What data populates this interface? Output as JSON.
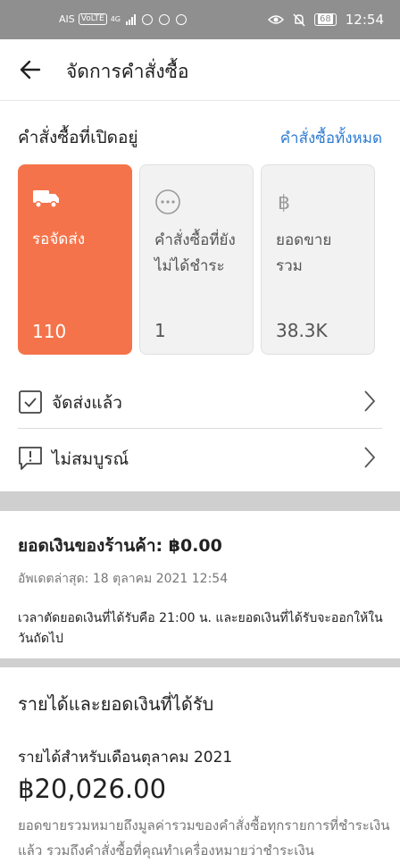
{
  "status_bar": {
    "carrier": "AIS",
    "volte": "VoLTE",
    "network": "4G",
    "battery": "68",
    "time": "12:54"
  },
  "header": {
    "title": "จัดการคำสั่งซื้อ"
  },
  "open_orders": {
    "title": "คำสั่งซื้อที่เปิดอยู่",
    "all_link": "คำสั่งซื้อทั้งหมด",
    "cards": [
      {
        "icon": "truck-icon",
        "label": "รอจัดส่ง",
        "value": "110"
      },
      {
        "icon": "more-circle-icon",
        "label": "คำสั่งซื้อที่ยังไม่ได้ชำระ",
        "value": "1"
      },
      {
        "icon": "baht-icon",
        "label": "ยอดขายรวม",
        "value": "38.3K"
      }
    ]
  },
  "rows": [
    {
      "icon": "check-box-icon",
      "label": "จัดส่งแล้ว"
    },
    {
      "icon": "alert-message-icon",
      "label": "ไม่สมบูรณ์"
    }
  ],
  "balance": {
    "title": "ยอดเงินของร้านค้า: ฿0.00",
    "updated": "อัพเดตล่าสุด: 18 ตุลาคม 2021 12:54",
    "cutoff_note": "เวลาตัดยอดเงินที่ได้รับคือ 21:00 น. และยอดเงินที่ได้รับจะออกให้ในวันถัดไป"
  },
  "income": {
    "title": "รายได้และยอดเงินที่ได้รับ",
    "month_label": "รายได้สำหรับเดือนตุลาคม 2021",
    "amount": "฿20,026.00",
    "note": "ยอดขายรวมหมายถึงมูลค่ารวมของคำสั่งซื้อทุกรายการที่ชำระเงินแล้ว รวมถึงคำสั่งซื้อที่คุณทำเครื่องหมายว่าชำระเงิน"
  },
  "colors": {
    "accent": "#f5734a",
    "link": "#2e7bd3",
    "status_bar": "#8f8f8f"
  }
}
